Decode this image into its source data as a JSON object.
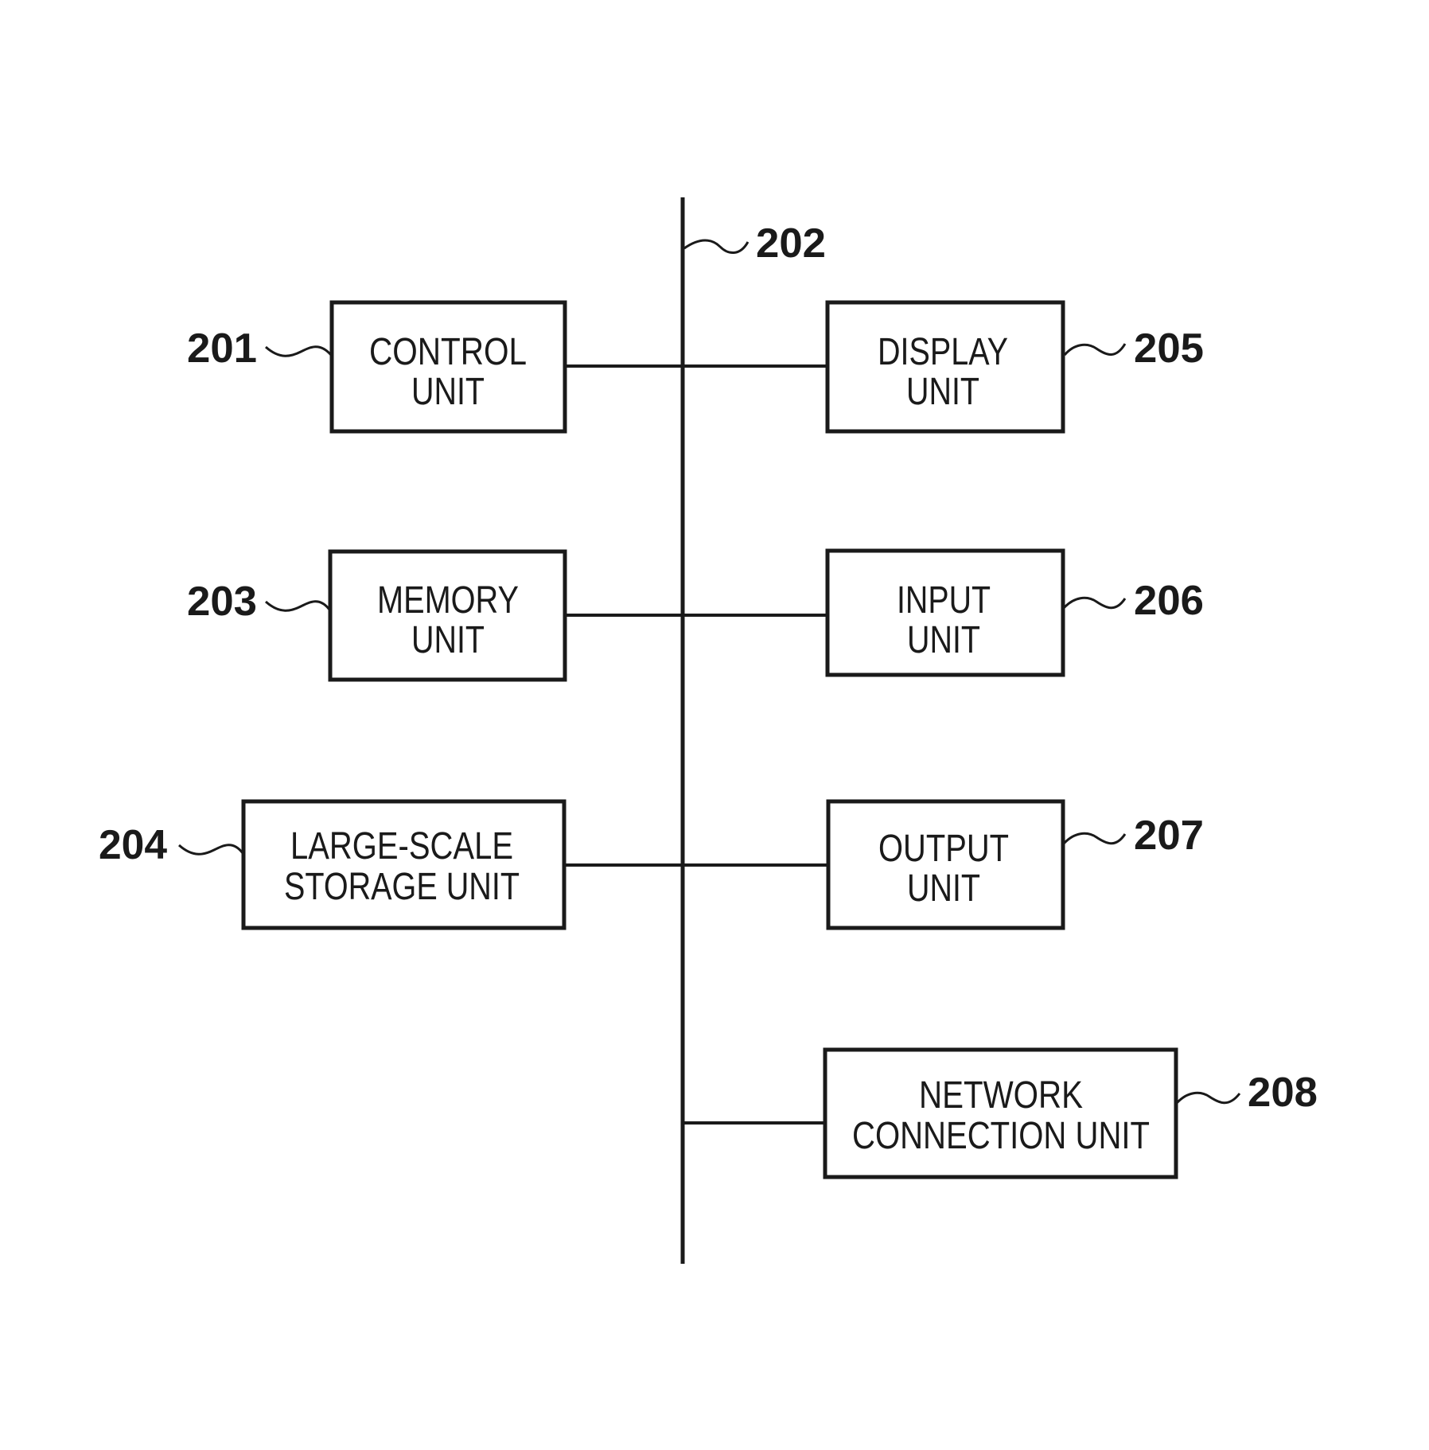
{
  "figure": {
    "bus": {
      "ref": "202"
    },
    "blocks": [
      {
        "id": "control",
        "ref": "201",
        "line1": "CONTROL",
        "line2": "UNIT"
      },
      {
        "id": "memory",
        "ref": "203",
        "line1": "MEMORY",
        "line2": "UNIT"
      },
      {
        "id": "storage",
        "ref": "204",
        "line1": "LARGE-SCALE",
        "line2": "STORAGE UNIT"
      },
      {
        "id": "display",
        "ref": "205",
        "line1": "DISPLAY",
        "line2": "UNIT"
      },
      {
        "id": "input",
        "ref": "206",
        "line1": "INPUT",
        "line2": "UNIT"
      },
      {
        "id": "output",
        "ref": "207",
        "line1": "OUTPUT",
        "line2": "UNIT"
      },
      {
        "id": "network",
        "ref": "208",
        "line1": "NETWORK",
        "line2": "CONNECTION UNIT"
      }
    ]
  },
  "colors": {
    "ink": "#1a1a1a",
    "background": "#ffffff"
  }
}
